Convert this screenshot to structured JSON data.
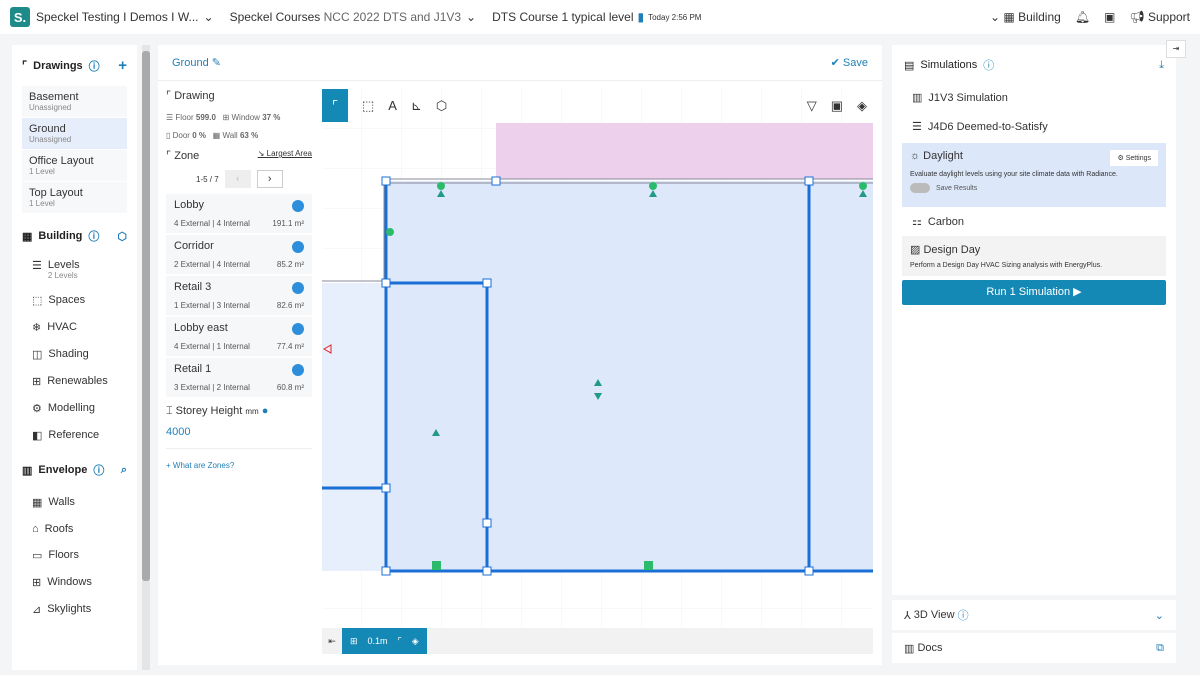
{
  "topbar": {
    "logo": "S.",
    "project": "Speckel Testing I Demos I W...",
    "course": "Speckel Courses",
    "course_sub": "NCC 2022 DTS and J1V3",
    "level": "DTS Course 1 typical level",
    "saved": "Today 2:56 PM",
    "building": "Building",
    "support": "Support"
  },
  "sidebar": {
    "drawings_title": "Drawings",
    "drawings": [
      {
        "name": "Basement",
        "sub": "Unassigned"
      },
      {
        "name": "Ground",
        "sub": "Unassigned"
      },
      {
        "name": "Office Layout",
        "sub": "1 Level"
      },
      {
        "name": "Top Layout",
        "sub": "1 Level"
      }
    ],
    "building_title": "Building",
    "building_items": [
      {
        "label": "Levels",
        "sub": "2 Levels"
      },
      {
        "label": "Spaces"
      },
      {
        "label": "HVAC"
      },
      {
        "label": "Shading"
      },
      {
        "label": "Renewables"
      },
      {
        "label": "Modelling"
      },
      {
        "label": "Reference"
      }
    ],
    "envelope_title": "Envelope",
    "envelope_items": [
      "Walls",
      "Roofs",
      "Floors",
      "Windows",
      "Skylights"
    ]
  },
  "main": {
    "title": "Ground",
    "save": "Save",
    "drawing": {
      "title": "Drawing",
      "floor_label": "Floor",
      "floor": "599.0",
      "window_label": "Window",
      "window": "37 %",
      "door_label": "Door",
      "door": "0 %",
      "wall_label": "Wall",
      "wall": "63 %"
    },
    "zone": {
      "title": "Zone",
      "sort": "Largest Area",
      "page": "1-5 / 7",
      "zones": [
        {
          "name": "Lobby",
          "ext": "4 External",
          "int": "4 Internal",
          "area": "191.1 m²"
        },
        {
          "name": "Corridor",
          "ext": "2 External",
          "int": "4 Internal",
          "area": "85.2 m²"
        },
        {
          "name": "Retail 3",
          "ext": "1 External",
          "int": "3 Internal",
          "area": "82.6 m²"
        },
        {
          "name": "Lobby east",
          "ext": "4 External",
          "int": "1 Internal",
          "area": "77.4 m²"
        },
        {
          "name": "Retail 1",
          "ext": "3 External",
          "int": "2 Internal",
          "area": "60.8 m²"
        }
      ]
    },
    "storey_label": "Storey Height",
    "storey_unit": "mm",
    "storey": "4000",
    "help": "What are Zones?",
    "scale": "0.1m"
  },
  "simulations": {
    "title": "Simulations",
    "items": [
      {
        "label": "J1V3 Simulation"
      },
      {
        "label": "J4D6 Deemed-to-Satisfy"
      }
    ],
    "daylight": {
      "label": "Daylight",
      "settings": "Settings",
      "desc": "Evaluate daylight levels using your site climate data with Radiance.",
      "toggle": "Save Results"
    },
    "carbon": "Carbon",
    "design_day": {
      "label": "Design Day",
      "desc": "Perform a Design Day HVAC Sizing analysis with EnergyPlus."
    },
    "run": "Run 1 Simulation ▶",
    "view3d": "3D View",
    "docs": "Docs"
  }
}
